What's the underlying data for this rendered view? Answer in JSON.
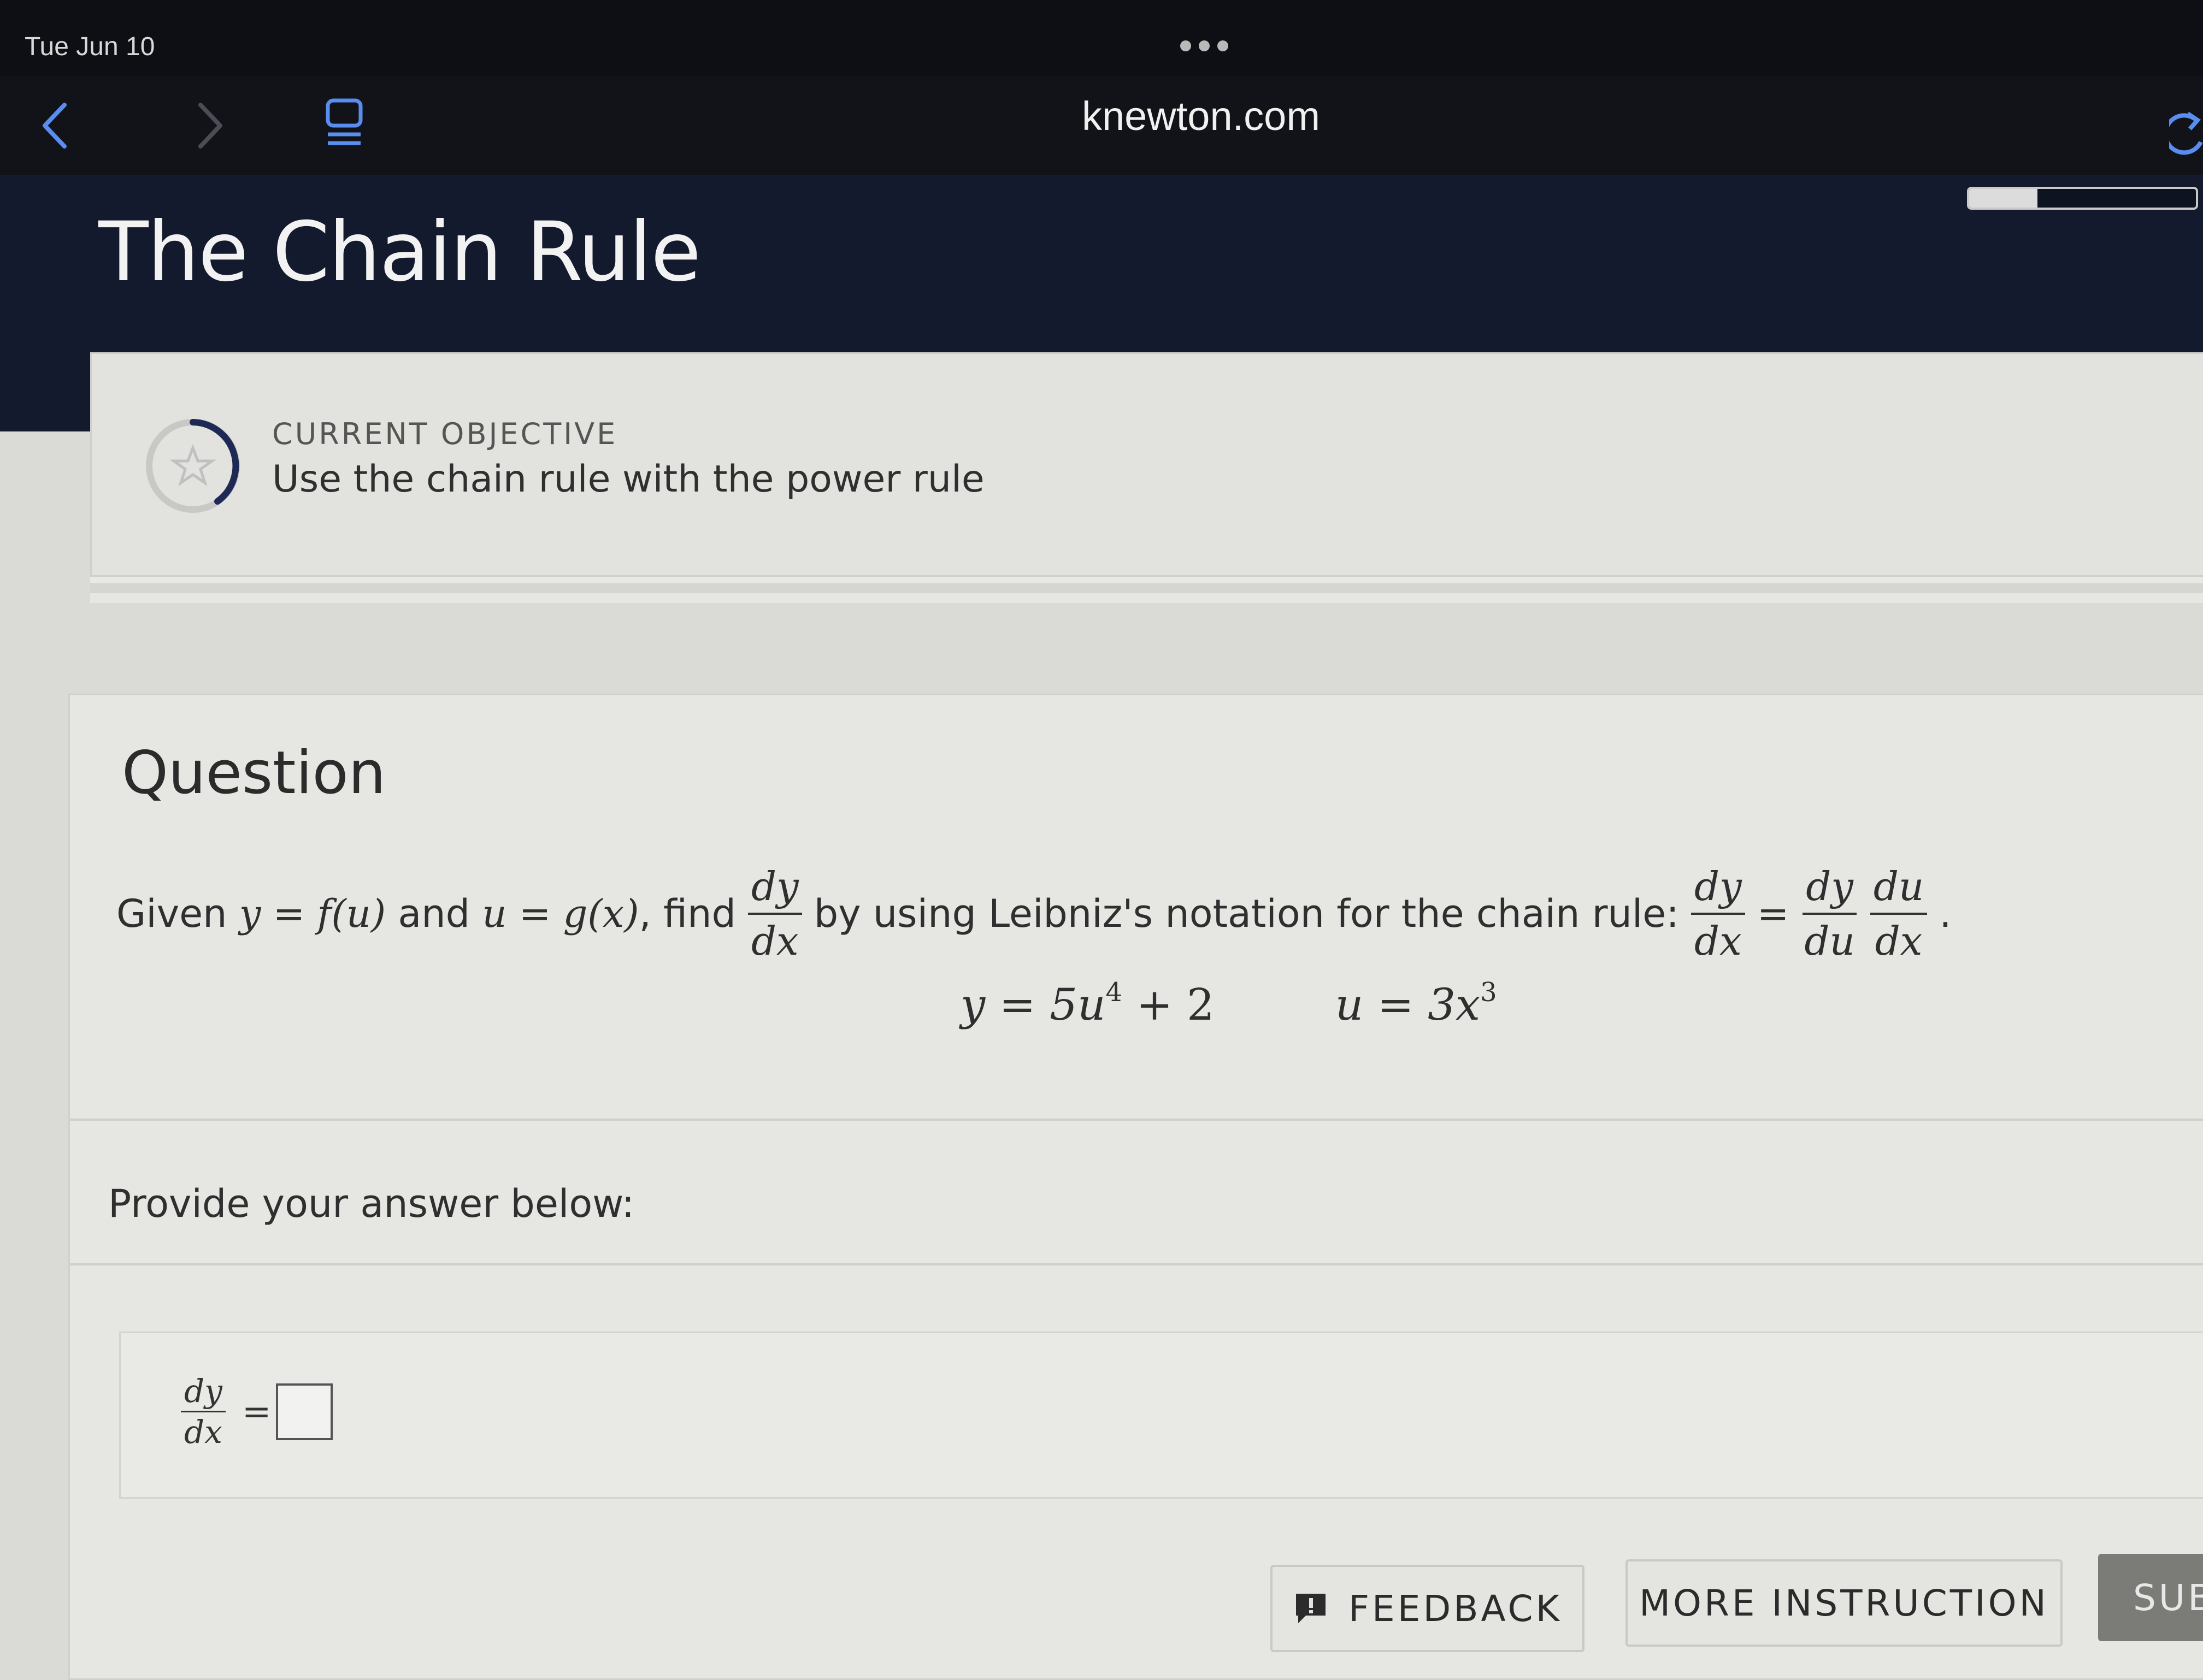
{
  "status": {
    "date": "Tue Jun 10"
  },
  "browser": {
    "url": "knewton.com"
  },
  "header": {
    "title": "The Chain Rule",
    "progress_fraction": 0.3
  },
  "objective": {
    "label": "CURRENT OBJECTIVE",
    "text": "Use the chain rule with the power rule"
  },
  "question": {
    "heading": "Question",
    "given": "Given",
    "y_eq_fu": "y = f(u)",
    "and": "and",
    "u_eq_gx": "u = g(x)",
    "find": ", find",
    "dy": "dy",
    "dx": "dx",
    "du": "du",
    "by_using": "by using Leibniz's notation for the chain rule:",
    "equals": "=",
    "period": ".",
    "equation_y": "y = 5u",
    "exp_y": "4",
    "equation_y_tail": " + 2",
    "equation_u": "u = 3x",
    "exp_u": "3"
  },
  "answer": {
    "prompt": "Provide your answer below:",
    "lhs_num": "dy",
    "lhs_den": "dx",
    "equals": "=",
    "value": ""
  },
  "buttons": {
    "feedback": "FEEDBACK",
    "more_instruction": "MORE INSTRUCTION",
    "submit": "SUB"
  }
}
